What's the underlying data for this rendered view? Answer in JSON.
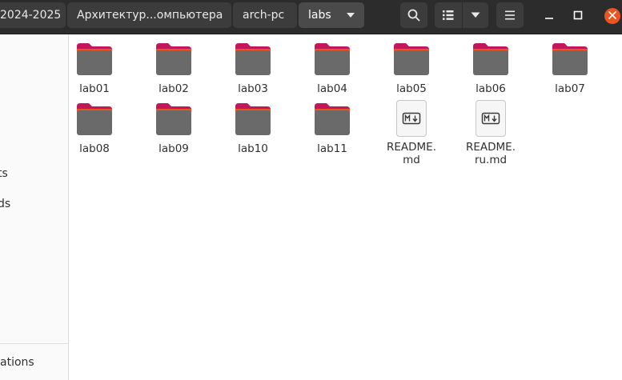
{
  "breadcrumb": {
    "items": [
      {
        "label": "2024-2025"
      },
      {
        "label": "Архитектур...омпьютера"
      },
      {
        "label": "arch-pc"
      },
      {
        "label": "labs"
      }
    ]
  },
  "toolbar": {
    "search_icon": "search-icon",
    "view_icon": "list-view-icon",
    "view_menu_icon": "chevron-down-icon",
    "menu_icon": "hamburger-menu-icon"
  },
  "window_controls": {
    "minimize_icon": "minimize-icon",
    "maximize_icon": "maximize-icon",
    "close_icon": "close-icon",
    "close_color": "#e95420"
  },
  "sidebar": {
    "items": [
      {
        "label": "ts"
      },
      {
        "label": "ds"
      },
      {
        "label": "ations"
      }
    ]
  },
  "folder_colors": {
    "body": "#6a6a6a",
    "tab": "#c2185b",
    "accent": "#e95420"
  },
  "files": [
    {
      "name": "lab01",
      "kind": "folder"
    },
    {
      "name": "lab02",
      "kind": "folder"
    },
    {
      "name": "lab03",
      "kind": "folder"
    },
    {
      "name": "lab04",
      "kind": "folder"
    },
    {
      "name": "lab05",
      "kind": "folder"
    },
    {
      "name": "lab06",
      "kind": "folder"
    },
    {
      "name": "lab07",
      "kind": "folder"
    },
    {
      "name": "lab08",
      "kind": "folder"
    },
    {
      "name": "lab09",
      "kind": "folder"
    },
    {
      "name": "lab10",
      "kind": "folder"
    },
    {
      "name": "lab11",
      "kind": "folder"
    },
    {
      "name": "README.\nmd",
      "kind": "markdown"
    },
    {
      "name": "README.\nru.md",
      "kind": "markdown"
    }
  ]
}
